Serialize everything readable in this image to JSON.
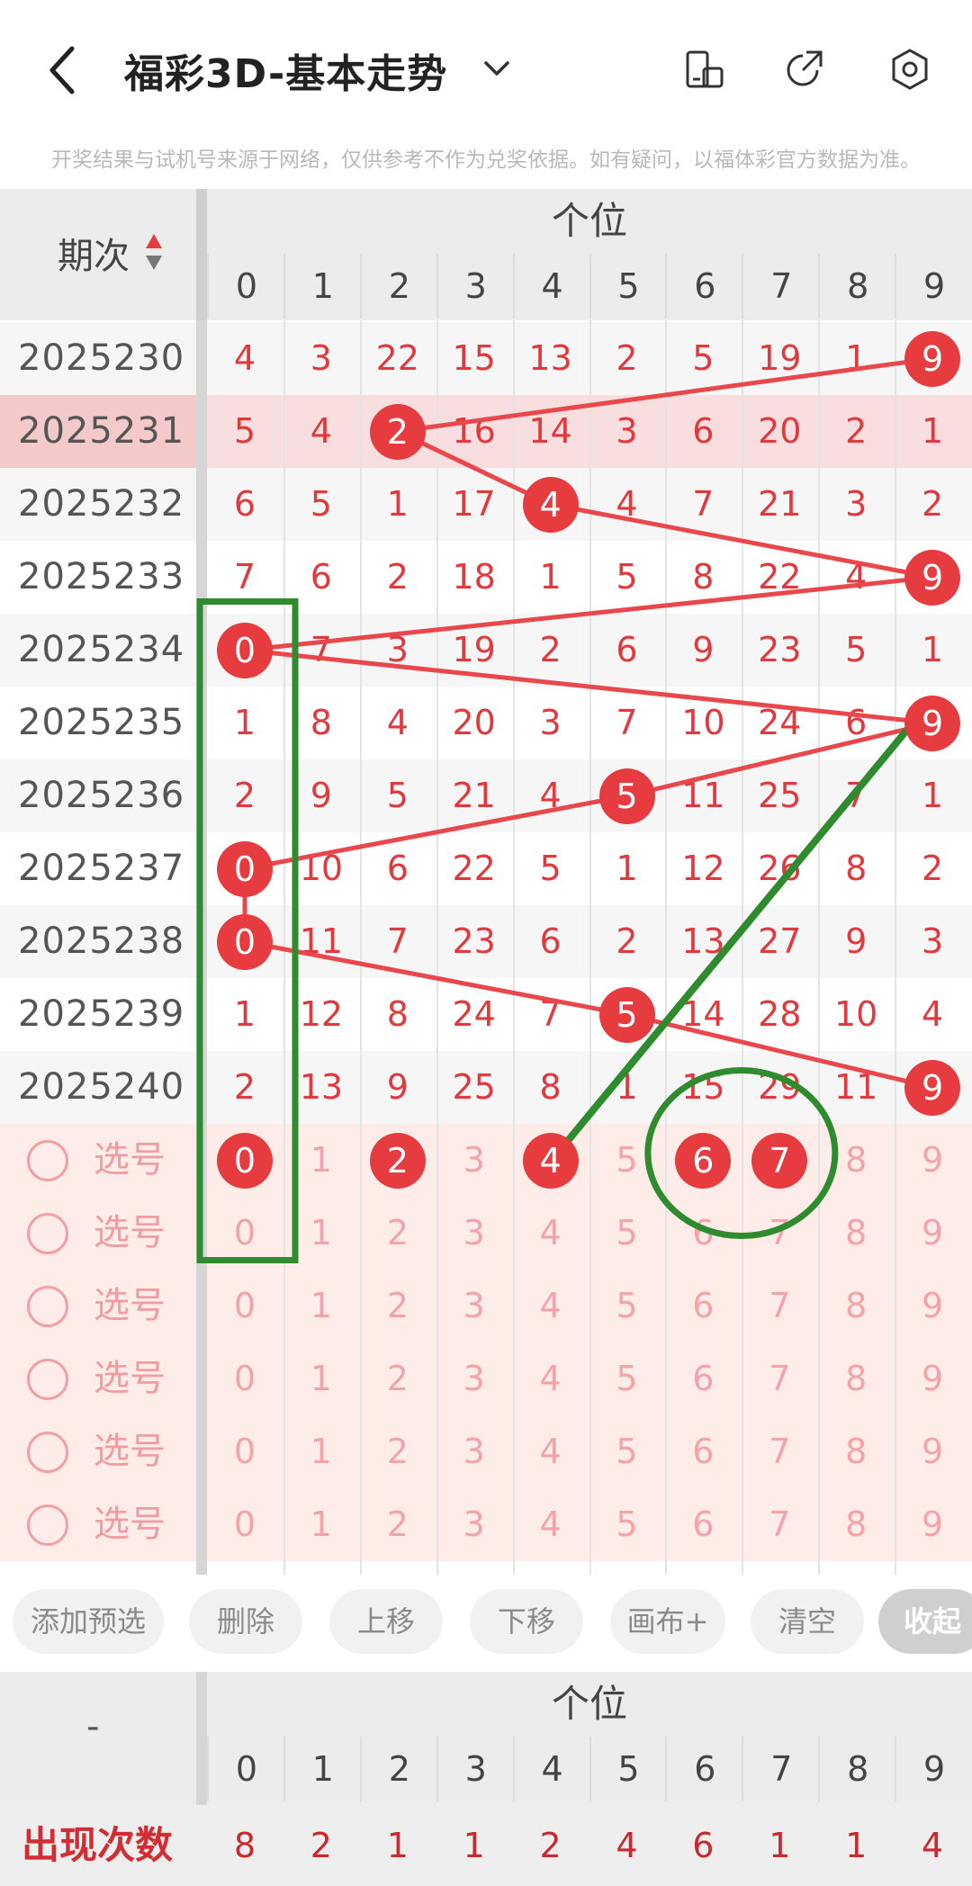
{
  "header": {
    "title": "福彩3D-基本走势",
    "notice": "开奖结果与试机号来源于网络，仅供参考不作为兑奖依据。如有疑问，以福体彩官方数据为准。",
    "icons": [
      "back-arrow-icon",
      "dropdown-chevron-icon",
      "phone-icon",
      "share-icon",
      "settings-icon"
    ]
  },
  "table": {
    "period_header": "期次",
    "group_header": "个位",
    "columns": [
      "0",
      "1",
      "2",
      "3",
      "4",
      "5",
      "6",
      "7",
      "8",
      "9"
    ],
    "rows": [
      {
        "period": "2025230",
        "cells": [
          "4",
          "3",
          "22",
          "15",
          "13",
          "2",
          "5",
          "19",
          "1",
          "9"
        ],
        "hit": 9
      },
      {
        "period": "2025231",
        "cells": [
          "5",
          "4",
          "2",
          "16",
          "14",
          "3",
          "6",
          "20",
          "2",
          "1"
        ],
        "hit": 2
      },
      {
        "period": "2025232",
        "cells": [
          "6",
          "5",
          "1",
          "17",
          "4",
          "4",
          "7",
          "21",
          "3",
          "2"
        ],
        "hit": 4
      },
      {
        "period": "2025233",
        "cells": [
          "7",
          "6",
          "2",
          "18",
          "1",
          "5",
          "8",
          "22",
          "4",
          "9"
        ],
        "hit": 9
      },
      {
        "period": "2025234",
        "cells": [
          "0",
          "7",
          "3",
          "19",
          "2",
          "6",
          "9",
          "23",
          "5",
          "1"
        ],
        "hit": 0
      },
      {
        "period": "2025235",
        "cells": [
          "1",
          "8",
          "4",
          "20",
          "3",
          "7",
          "10",
          "24",
          "6",
          "9"
        ],
        "hit": 9
      },
      {
        "period": "2025236",
        "cells": [
          "2",
          "9",
          "5",
          "21",
          "4",
          "5",
          "11",
          "25",
          "7",
          "1"
        ],
        "hit": 5
      },
      {
        "period": "2025237",
        "cells": [
          "0",
          "10",
          "6",
          "22",
          "5",
          "1",
          "12",
          "26",
          "8",
          "2"
        ],
        "hit": 0
      },
      {
        "period": "2025238",
        "cells": [
          "0",
          "11",
          "7",
          "23",
          "6",
          "2",
          "13",
          "27",
          "9",
          "3"
        ],
        "hit": 0
      },
      {
        "period": "2025239",
        "cells": [
          "1",
          "12",
          "8",
          "24",
          "7",
          "5",
          "14",
          "28",
          "10",
          "4"
        ],
        "hit": 5
      },
      {
        "period": "2025240",
        "cells": [
          "2",
          "13",
          "9",
          "25",
          "8",
          "1",
          "15",
          "29",
          "11",
          "9"
        ],
        "hit": 9
      }
    ]
  },
  "selection": {
    "label": "选号",
    "rows": [
      {
        "selected": [
          0,
          2,
          4,
          6,
          7
        ]
      },
      {
        "selected": []
      },
      {
        "selected": []
      },
      {
        "selected": []
      },
      {
        "selected": []
      },
      {
        "selected": []
      }
    ]
  },
  "toolbar": {
    "buttons": [
      "添加预选",
      "删除",
      "上移",
      "下移",
      "画布+",
      "清空",
      "收起"
    ]
  },
  "stats": {
    "row_header": "-",
    "group_header": "个位",
    "label": "出现次数",
    "values": [
      "8",
      "2",
      "1",
      "1",
      "2",
      "4",
      "6",
      "1",
      "1",
      "4"
    ]
  },
  "colors": {
    "accent_red": "#e63b3f",
    "line_red": "#e8474c",
    "annotation_green": "#2e8b2e",
    "selection_bg": "#fdece7",
    "highlight_row_bg": "#f6d3d4"
  }
}
